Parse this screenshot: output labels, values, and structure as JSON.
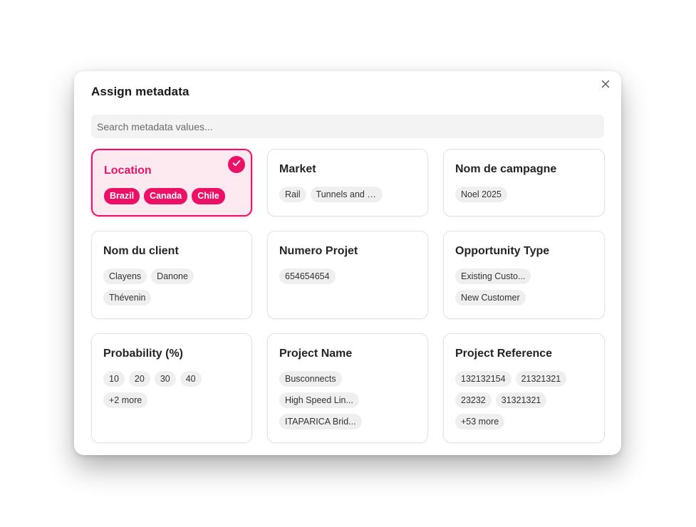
{
  "modal": {
    "title": "Assign metadata",
    "search_placeholder": "Search metadata values...",
    "accent_color": "#ec1066"
  },
  "cards": [
    {
      "title": "Location",
      "selected": true,
      "values": [
        "Brazil",
        "Canada",
        "Chile"
      ]
    },
    {
      "title": "Market",
      "selected": false,
      "values": [
        "Rail",
        "Tunnels and Bri..."
      ]
    },
    {
      "title": "Nom de campagne",
      "selected": false,
      "values": [
        "Noel 2025"
      ]
    },
    {
      "title": "Nom du client",
      "selected": false,
      "values": [
        "Clayens",
        "Danone",
        "Thévenin"
      ]
    },
    {
      "title": "Numero Projet",
      "selected": false,
      "values": [
        "654654654"
      ]
    },
    {
      "title": "Opportunity Type",
      "selected": false,
      "values": [
        "Existing Custo...",
        "New Customer"
      ]
    },
    {
      "title": "Probability (%)",
      "selected": false,
      "values": [
        "10",
        "20",
        "30",
        "40",
        "+2 more"
      ]
    },
    {
      "title": "Project Name",
      "selected": false,
      "values": [
        "Busconnects",
        "High Speed Lin...",
        "ITAPARICA Brid..."
      ]
    },
    {
      "title": "Project Reference",
      "selected": false,
      "values": [
        "132132154",
        "21321321",
        "23232",
        "31321321",
        "+53 more"
      ]
    }
  ]
}
